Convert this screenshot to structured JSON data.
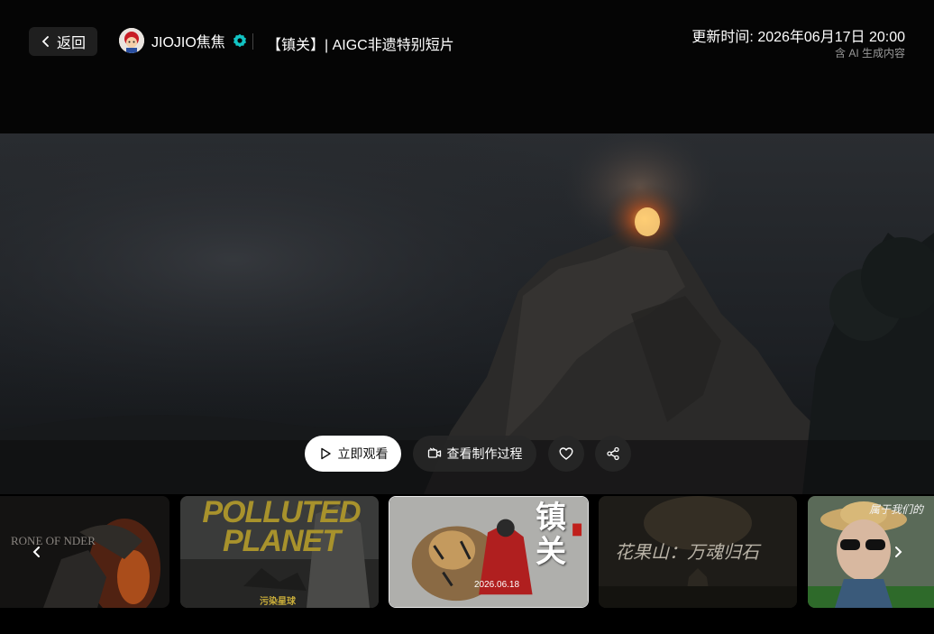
{
  "header": {
    "back_label": "返回",
    "author_name": "JIOJIO焦焦",
    "work_title": "【镇关】| AIGC非遗特别短片",
    "update_time": "更新时间: 2026年06月17日 20:00",
    "ai_note": "含 AI 生成内容"
  },
  "actions": {
    "watch_label": "立即观看",
    "process_label": "查看制作过程"
  },
  "carousel": {
    "items": [
      {
        "label": "RONE OF NDER"
      },
      {
        "label": "POLLUTED PLANET",
        "sub": "污染星球"
      },
      {
        "label": "镇关",
        "sub": "2026.06.18"
      },
      {
        "label": "花果山：万魂归石"
      },
      {
        "label": "属于我们的"
      }
    ]
  },
  "colors": {
    "accent_verified": "#12c4c4",
    "background": "#000000",
    "panel": "#1f1f1f"
  }
}
